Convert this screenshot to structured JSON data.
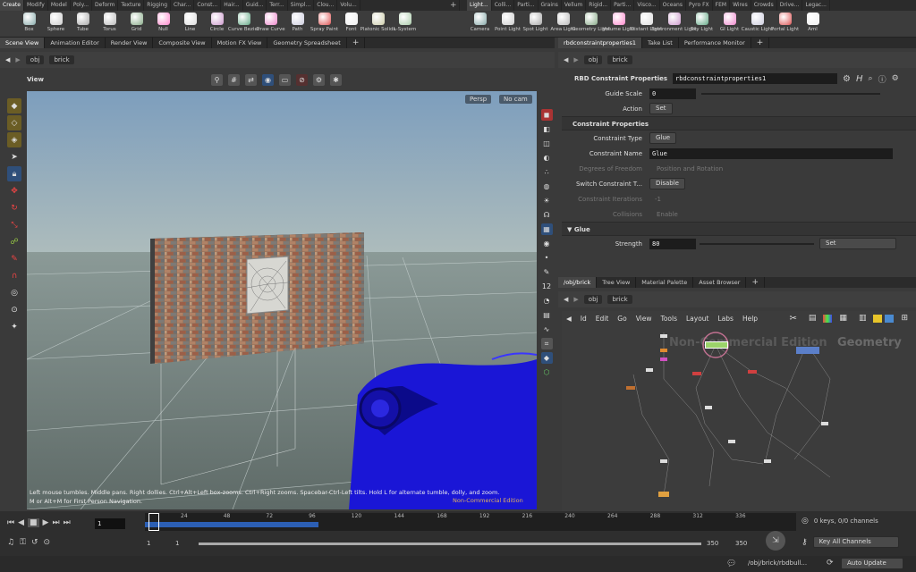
{
  "shelf_tabs_left": [
    "Create",
    "Modify",
    "Model",
    "Poly...",
    "Deform",
    "Texture",
    "Rigging",
    "Char...",
    "Const...",
    "Hair...",
    "Guid...",
    "Terr...",
    "Simpl...",
    "Clou...",
    "Volu..."
  ],
  "shelf_tabs_right": [
    "Light...",
    "Colli...",
    "Parti...",
    "Grains",
    "Vellum",
    "Rigid...",
    "Parti...",
    "Visco...",
    "Oceans",
    "Pyro FX",
    "FEM",
    "Wires",
    "Crowds",
    "Drive...",
    "Legac..."
  ],
  "shelf_tools_left": [
    {
      "label": "Box",
      "icon": "box-icon"
    },
    {
      "label": "Sphere",
      "icon": "sphere-icon"
    },
    {
      "label": "Tube",
      "icon": "tube-icon"
    },
    {
      "label": "Torus",
      "icon": "torus-icon"
    },
    {
      "label": "Grid",
      "icon": "grid-icon"
    },
    {
      "label": "Null",
      "icon": "null-icon"
    },
    {
      "label": "Line",
      "icon": "line-icon"
    },
    {
      "label": "Circle",
      "icon": "circle-icon"
    },
    {
      "label": "Curve Bezier",
      "icon": "curve-bezier-icon"
    },
    {
      "label": "Draw Curve",
      "icon": "draw-curve-icon"
    },
    {
      "label": "Path",
      "icon": "path-icon"
    },
    {
      "label": "Spray Paint",
      "icon": "spray-paint-icon"
    },
    {
      "label": "Font",
      "icon": "font-icon"
    },
    {
      "label": "Platonic Solids",
      "icon": "platonic-icon"
    },
    {
      "label": "L-System",
      "icon": "lsystem-icon"
    }
  ],
  "shelf_tools_right": [
    {
      "label": "Camera",
      "icon": "camera-icon"
    },
    {
      "label": "Point Light",
      "icon": "point-light-icon"
    },
    {
      "label": "Spot Light",
      "icon": "spot-light-icon"
    },
    {
      "label": "Area Light",
      "icon": "area-light-icon"
    },
    {
      "label": "Geometry Light",
      "icon": "geometry-light-icon"
    },
    {
      "label": "Volume Light",
      "icon": "volume-light-icon"
    },
    {
      "label": "Distant Light",
      "icon": "distant-light-icon"
    },
    {
      "label": "Environment Light",
      "icon": "env-light-icon"
    },
    {
      "label": "Sky Light",
      "icon": "sky-light-icon"
    },
    {
      "label": "GI Light",
      "icon": "gi-light-icon"
    },
    {
      "label": "Caustic Light",
      "icon": "caustic-light-icon"
    },
    {
      "label": "Portal Light",
      "icon": "portal-light-icon"
    },
    {
      "label": "Aml",
      "icon": "ambient-light-icon"
    }
  ],
  "left_pane_tabs": [
    "Scene View",
    "Animation Editor",
    "Render View",
    "Composite View",
    "Motion FX View",
    "Geometry Spreadsheet"
  ],
  "right_pane_tabs": [
    "rbdconstraintproperties1",
    "Take List",
    "Performance Monitor"
  ],
  "network_tabs": [
    "/obj/brick",
    "Tree View",
    "Material Palette",
    "Asset Browser"
  ],
  "path": {
    "root": "obj",
    "node": "brick"
  },
  "viewer": {
    "title": "View",
    "persp": "Persp",
    "cam": "No cam",
    "help_text": "Left mouse tumbles. Middle pans. Right dollies. Ctrl+Alt+Left box-zooms. Ctrl+Right zooms. Spacebar-Ctrl-Left tilts. Hold L for alternate tumble, dolly, and zoom.",
    "help_text2": "M or Alt+M for First Person Navigation.",
    "watermark": "Non-Commercial Edition"
  },
  "params": {
    "node_type": "RBD Constraint Properties",
    "node_name": "rbdconstraintproperties1",
    "guide_scale_label": "Guide Scale",
    "guide_scale": "0",
    "action_label": "Action",
    "action": "Set",
    "section_constraint": "Constraint Properties",
    "ctype_label": "Constraint Type",
    "ctype": "Glue",
    "cname_label": "Constraint Name",
    "cname": "Glue",
    "dof_label": "Degrees of Freedom",
    "dof": "Position and Rotation",
    "switch_label": "Switch Constraint T...",
    "switch": "Disable",
    "iter_label": "Constraint Iterations",
    "iter": "-1",
    "coll_label": "Collisions",
    "coll": "Enable",
    "section_glue": "Glue",
    "strength_label": "Strength",
    "strength": "80",
    "strength_action": "Set"
  },
  "network_menu": [
    "Id",
    "Edit",
    "Go",
    "View",
    "Tools",
    "Layout",
    "Labs",
    "Help"
  ],
  "network": {
    "watermark": "Non-Commercial Edition",
    "context": "Geometry"
  },
  "timeline": {
    "ticks": [
      "24",
      "48",
      "72",
      "96",
      "120",
      "144",
      "168",
      "192",
      "216",
      "240",
      "264",
      "288",
      "312",
      "336"
    ],
    "frame": "1",
    "start": "1",
    "start2": "1",
    "end": "350",
    "end2": "350",
    "keys": "0 keys, 0/0 channels",
    "key_all": "Key All Channels"
  },
  "status": {
    "path": "/obj/brick/rbdbull...",
    "update": "Auto Update"
  },
  "colors": {
    "accent": "#4a90d9",
    "sky_top": "#7f9fbd",
    "sky_bottom": "#a9b8b6",
    "car": "#1a16d6",
    "selected": "#9bd36a"
  }
}
